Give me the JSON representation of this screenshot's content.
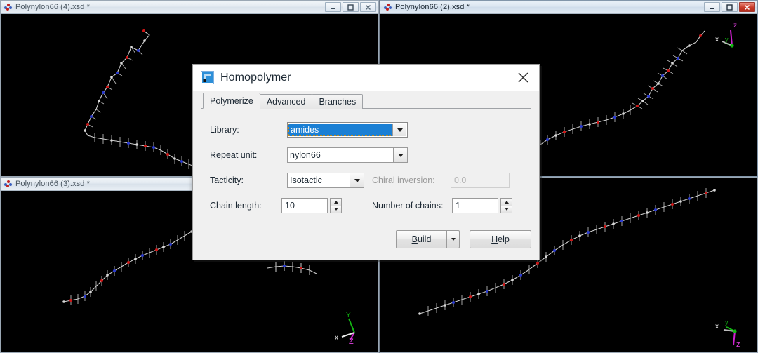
{
  "windows": [
    {
      "id": "win-4",
      "title": "Polynylon66 (4).xsd *",
      "active": false,
      "controls": {
        "minimize": "Minimize",
        "maximize": "Maximize",
        "close": "Close"
      },
      "gizmo": null
    },
    {
      "id": "win-2",
      "title": "Polynylon66 (2).xsd *",
      "active": true,
      "controls": {
        "minimize": "Minimize",
        "maximize": "Maximize",
        "close": "Close"
      },
      "gizmo": {
        "x_label": "x",
        "y_label": "y",
        "z_label": "z"
      }
    },
    {
      "id": "win-3",
      "title": "Polynylon66 (3).xsd *",
      "active": false,
      "controls": {
        "minimize": "Minimize",
        "maximize": "Maximize",
        "close": "Close"
      },
      "gizmo": {
        "x_label": "x",
        "y_label": "Y",
        "z_label": "Z"
      }
    },
    {
      "id": "win-1",
      "title": "",
      "active": false,
      "controls": {
        "minimize": "Minimize",
        "maximize": "Maximize",
        "close": "Close"
      },
      "gizmo": {
        "x_label": "x",
        "y_label": "y",
        "z_label": "z"
      }
    }
  ],
  "dialog": {
    "title": "Homopolymer",
    "icon": "homopolymer-icon",
    "close_label": "Close",
    "tabs": [
      {
        "label": "Polymerize",
        "selected": true
      },
      {
        "label": "Advanced",
        "selected": false
      },
      {
        "label": "Branches",
        "selected": false
      }
    ],
    "fields": {
      "library": {
        "label": "Library:",
        "value": "amides",
        "focused": true
      },
      "repeat_unit": {
        "label": "Repeat unit:",
        "value": "nylon66"
      },
      "tacticity": {
        "label": "Tacticity:",
        "value": "Isotactic"
      },
      "chiral_inversion": {
        "label": "Chiral inversion:",
        "value": "0.0",
        "disabled": true
      },
      "chain_length": {
        "label": "Chain length:",
        "value": "10"
      },
      "number_of_chains": {
        "label": "Number of chains:",
        "value": "1"
      }
    },
    "buttons": {
      "build": "Build",
      "build_accel": "B",
      "build_rest": "uild",
      "build_dropdown": "More build options",
      "help": "Help",
      "help_accel": "H",
      "help_rest": "elp"
    }
  },
  "colors": {
    "accent_selection": "#1a7fd4",
    "close_active": "#c93a29",
    "canvas": "#000000",
    "atom_carbon": "#d8d8d8",
    "atom_oxygen": "#d01616",
    "atom_nitrogen": "#2a3ad0",
    "axis_x": "#e8e8e8",
    "axis_y": "#12b612",
    "axis_z": "#d020d0"
  }
}
